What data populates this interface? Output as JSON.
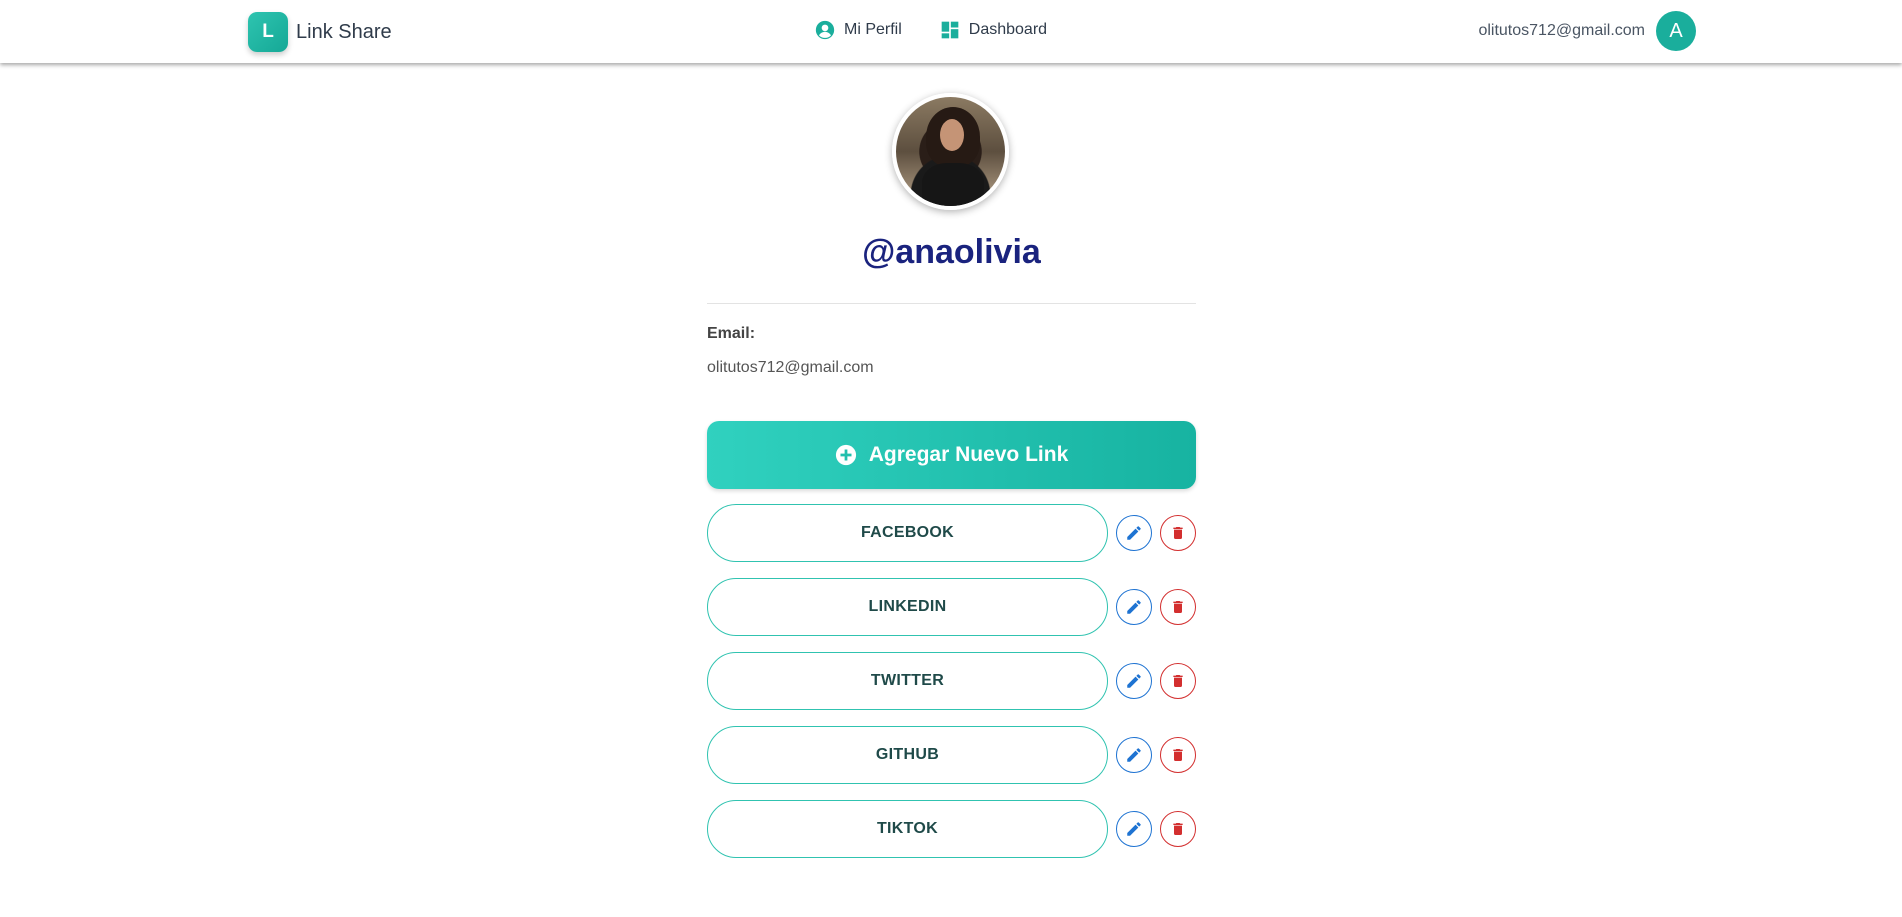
{
  "navbar": {
    "brand_letter": "L",
    "brand_name": "Link Share",
    "links": [
      {
        "label": "Mi Perfil",
        "icon": "user-circle-icon"
      },
      {
        "label": "Dashboard",
        "icon": "dashboard-icon"
      }
    ],
    "user_email": "olitutos712@gmail.com",
    "avatar_letter": "A"
  },
  "profile": {
    "username": "@anaolivia",
    "email_label": "Email:",
    "email_value": "olitutos712@gmail.com"
  },
  "add_link_button": {
    "label": "Agregar Nuevo Link",
    "icon": "plus-circle-icon"
  },
  "links": [
    {
      "label": "FACEBOOK"
    },
    {
      "label": "LINKEDIN"
    },
    {
      "label": "TWITTER"
    },
    {
      "label": "GITHUB"
    },
    {
      "label": "TIKTOK"
    }
  ],
  "colors": {
    "accent": "#1aae9c",
    "username": "#1a237e",
    "edit": "#1e73d2",
    "delete": "#d32f2f"
  }
}
